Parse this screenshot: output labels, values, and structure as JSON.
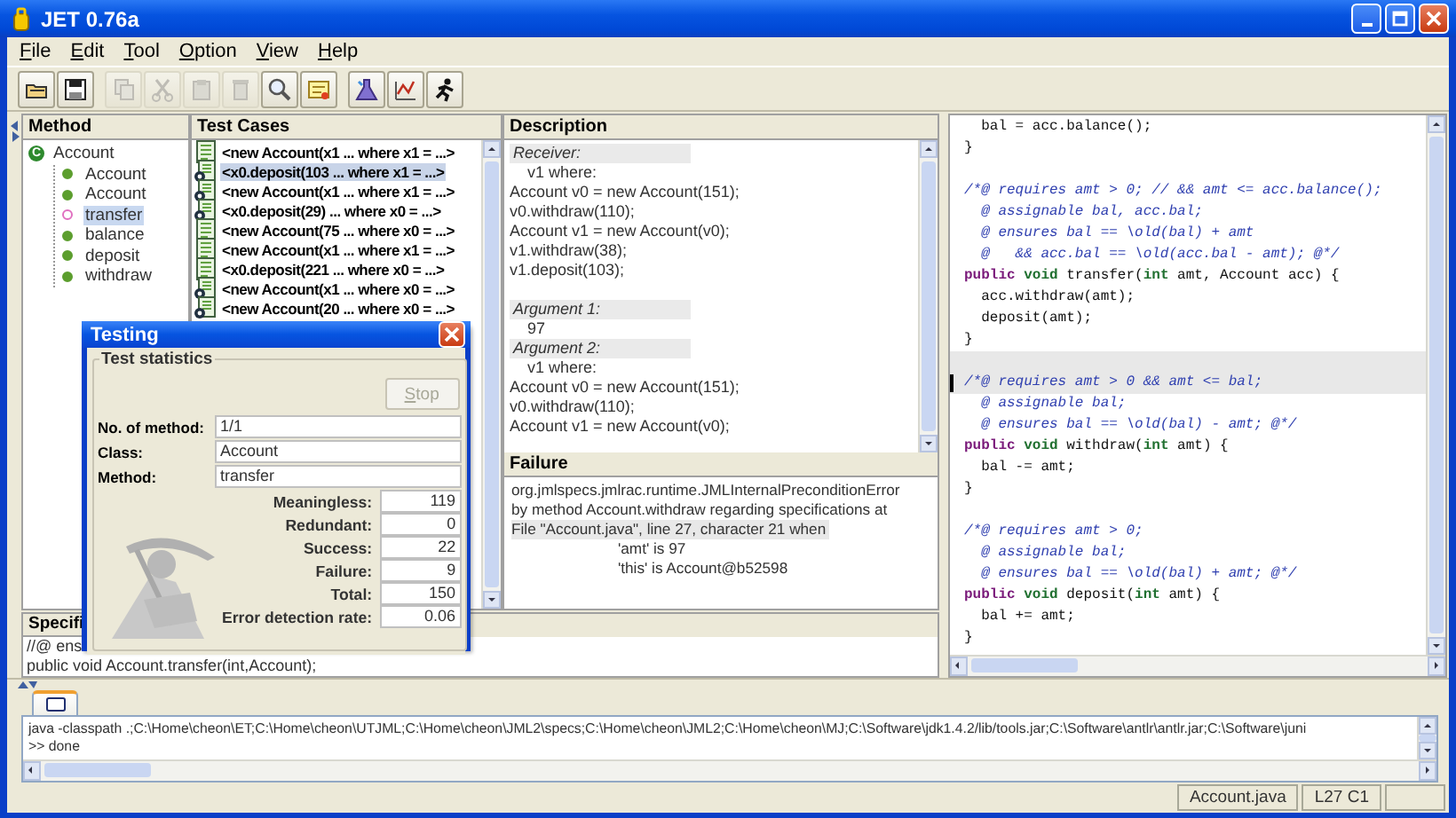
{
  "window": {
    "title": "JET 0.76a"
  },
  "menu": [
    "File",
    "Edit",
    "Tool",
    "Option",
    "View",
    "Help"
  ],
  "toolbar": [
    [
      {
        "kind": "open",
        "disabled": false
      },
      {
        "kind": "save",
        "disabled": false
      }
    ],
    [
      {
        "kind": "copy",
        "disabled": true
      },
      {
        "kind": "cut",
        "disabled": true
      },
      {
        "kind": "paste",
        "disabled": true
      },
      {
        "kind": "delete",
        "disabled": true
      },
      {
        "kind": "find",
        "disabled": false
      },
      {
        "kind": "note",
        "disabled": false
      }
    ],
    [
      {
        "kind": "spec",
        "disabled": false
      },
      {
        "kind": "chart",
        "disabled": false
      },
      {
        "kind": "run",
        "disabled": false
      }
    ]
  ],
  "method_panel": {
    "title": "Method",
    "root": {
      "label": "Account",
      "badge": "C",
      "children": [
        {
          "label": "Account",
          "kind": "filled",
          "color": "#5c9e2e",
          "selected": false
        },
        {
          "label": "Account",
          "kind": "filled",
          "color": "#5c9e2e",
          "selected": false
        },
        {
          "label": "transfer",
          "kind": "hollow",
          "color": "#e070c0",
          "selected": true
        },
        {
          "label": "balance",
          "kind": "filled",
          "color": "#5c9e2e",
          "selected": false
        },
        {
          "label": "deposit",
          "kind": "filled",
          "color": "#5c9e2e",
          "selected": false
        },
        {
          "label": "withdraw",
          "kind": "filled",
          "color": "#5c9e2e",
          "selected": false
        }
      ]
    }
  },
  "test_cases": {
    "title": "Test Cases",
    "rows": [
      {
        "kind": "plain",
        "text": "<new Account(x1 ... where x1 = ...>",
        "selected": false
      },
      {
        "kind": "marked",
        "text": "<x0.deposit(103 ... where x1 = ...>",
        "selected": true
      },
      {
        "kind": "marked",
        "text": "<new Account(x1 ... where x1 = ...>",
        "selected": false
      },
      {
        "kind": "marked",
        "text": "<x0.deposit(29) ... where x0 = ...>",
        "selected": false
      },
      {
        "kind": "plain",
        "text": "<new Account(75 ... where x0 = ...>",
        "selected": false
      },
      {
        "kind": "plain",
        "text": "<new Account(x1 ... where x1 = ...>",
        "selected": false
      },
      {
        "kind": "plain",
        "text": "<x0.deposit(221 ... where x0 = ...>",
        "selected": false
      },
      {
        "kind": "marked",
        "text": "<new Account(x1 ... where x0 = ...>",
        "selected": false
      },
      {
        "kind": "marked",
        "text": "<new Account(20 ... where x0 = ...>",
        "selected": false
      }
    ]
  },
  "description": {
    "title": "Description",
    "blocks": [
      {
        "kind": "heading",
        "text": "Receiver:"
      },
      {
        "kind": "indent",
        "text": "v1 where:"
      },
      {
        "kind": "code",
        "text": "Account v0 = new Account(151);"
      },
      {
        "kind": "code",
        "text": "v0.withdraw(110);"
      },
      {
        "kind": "code",
        "text": "Account v1 = new Account(v0);"
      },
      {
        "kind": "code",
        "text": "v1.withdraw(38);"
      },
      {
        "kind": "code",
        "text": "v1.deposit(103);"
      },
      {
        "kind": "gap"
      },
      {
        "kind": "heading",
        "text": "Argument 1:"
      },
      {
        "kind": "indent",
        "text": "97"
      },
      {
        "kind": "heading",
        "text": "Argument 2:"
      },
      {
        "kind": "indent",
        "text": "v1 where:"
      },
      {
        "kind": "code",
        "text": "Account v0 = new Account(151);"
      },
      {
        "kind": "code",
        "text": "v0.withdraw(110);"
      },
      {
        "kind": "code",
        "text": "Account v1 = new Account(v0);"
      }
    ]
  },
  "failure": {
    "title": "Failure",
    "lines": [
      {
        "kind": "plain",
        "text": "org.jmlspecs.jmlrac.runtime.JMLInternalPreconditionError"
      },
      {
        "kind": "plain",
        "text": "by method Account.withdraw regarding specifications at"
      },
      {
        "kind": "highlight",
        "text": "File \"Account.java\", line 27, character 21 when"
      },
      {
        "kind": "indent",
        "text": "'amt' is 97"
      },
      {
        "kind": "indent",
        "text": "'this' is Account@b52598"
      }
    ]
  },
  "specification": {
    "title": "Specifi",
    "lines": [
      "//@ ens",
      "public void Account.transfer(int,Account);"
    ]
  },
  "editor": {
    "lines": [
      {
        "current": false,
        "gap_before": false,
        "segments": [
          {
            "kind": "plain",
            "text": "  bal = acc.balance();"
          }
        ]
      },
      {
        "current": false,
        "gap_before": false,
        "segments": [
          {
            "kind": "plain",
            "text": "}"
          }
        ]
      },
      {
        "current": false,
        "gap_before": true,
        "segments": [
          {
            "kind": "comment",
            "text": "/*@ requires amt > 0; // && amt <= acc.balance();"
          }
        ]
      },
      {
        "current": false,
        "gap_before": false,
        "segments": [
          {
            "kind": "comment",
            "text": "  @ assignable bal, acc.bal;"
          }
        ]
      },
      {
        "current": false,
        "gap_before": false,
        "segments": [
          {
            "kind": "comment",
            "text": "  @ ensures bal == \\old(bal) + amt"
          }
        ]
      },
      {
        "current": false,
        "gap_before": false,
        "segments": [
          {
            "kind": "comment",
            "text": "  @   && acc.bal == \\old(acc.bal - amt); @*/"
          }
        ]
      },
      {
        "current": false,
        "gap_before": false,
        "segments": [
          {
            "kind": "keyword",
            "text": "public"
          },
          {
            "kind": "type",
            "text": " void"
          },
          {
            "kind": "plain",
            "text": " transfer("
          },
          {
            "kind": "type",
            "text": "int"
          },
          {
            "kind": "plain",
            "text": " amt, Account acc) {"
          }
        ]
      },
      {
        "current": false,
        "gap_before": false,
        "segments": [
          {
            "kind": "plain",
            "text": "  acc.withdraw(amt);"
          }
        ]
      },
      {
        "current": false,
        "gap_before": false,
        "segments": [
          {
            "kind": "plain",
            "text": "  deposit(amt);"
          }
        ]
      },
      {
        "current": false,
        "gap_before": false,
        "segments": [
          {
            "kind": "plain",
            "text": "}"
          }
        ]
      },
      {
        "current": true,
        "gap_before": true,
        "segments": [
          {
            "kind": "comment",
            "text": "/*@ requires amt > 0 && amt <= bal;"
          }
        ]
      },
      {
        "current": false,
        "gap_before": false,
        "segments": [
          {
            "kind": "comment",
            "text": "  @ assignable bal;"
          }
        ]
      },
      {
        "current": false,
        "gap_before": false,
        "segments": [
          {
            "kind": "comment",
            "text": "  @ ensures bal == \\old(bal) - amt; @*/"
          }
        ]
      },
      {
        "current": false,
        "gap_before": false,
        "segments": [
          {
            "kind": "keyword",
            "text": "public"
          },
          {
            "kind": "type",
            "text": " void"
          },
          {
            "kind": "plain",
            "text": " withdraw("
          },
          {
            "kind": "type",
            "text": "int"
          },
          {
            "kind": "plain",
            "text": " amt) {"
          }
        ]
      },
      {
        "current": false,
        "gap_before": false,
        "segments": [
          {
            "kind": "plain",
            "text": "  bal -= amt;"
          }
        ]
      },
      {
        "current": false,
        "gap_before": false,
        "segments": [
          {
            "kind": "plain",
            "text": "}"
          }
        ]
      },
      {
        "current": false,
        "gap_before": true,
        "segments": [
          {
            "kind": "comment",
            "text": "/*@ requires amt > 0;"
          }
        ]
      },
      {
        "current": false,
        "gap_before": false,
        "segments": [
          {
            "kind": "comment",
            "text": "  @ assignable bal;"
          }
        ]
      },
      {
        "current": false,
        "gap_before": false,
        "segments": [
          {
            "kind": "comment",
            "text": "  @ ensures bal == \\old(bal) + amt; @*/"
          }
        ]
      },
      {
        "current": false,
        "gap_before": false,
        "segments": [
          {
            "kind": "keyword",
            "text": "public"
          },
          {
            "kind": "type",
            "text": " void"
          },
          {
            "kind": "plain",
            "text": " deposit("
          },
          {
            "kind": "type",
            "text": "int"
          },
          {
            "kind": "plain",
            "text": " amt) {"
          }
        ]
      },
      {
        "current": false,
        "gap_before": false,
        "segments": [
          {
            "kind": "plain",
            "text": "  bal += amt;"
          }
        ]
      },
      {
        "current": false,
        "gap_before": false,
        "segments": [
          {
            "kind": "plain",
            "text": "}"
          }
        ]
      }
    ]
  },
  "console": {
    "tab": {
      "selected": true
    },
    "lines": [
      "java -classpath .;C:\\Home\\cheon\\ET;C:\\Home\\cheon\\UTJML;C:\\Home\\cheon\\JML2\\specs;C:\\Home\\cheon\\JML2;C:\\Home\\cheon\\MJ;C:\\Software\\jdk1.4.2/lib/tools.jar;C:\\Software\\antlr\\antlr.jar;C:\\Software\\juni",
      ">> done"
    ]
  },
  "status_bar": [
    "Account.java",
    "L27 C1"
  ],
  "dialog": {
    "title": "Testing",
    "group": "Test statistics",
    "stop": {
      "label": "Stop",
      "disabled": true
    },
    "fields": [
      {
        "label": "No. of method:",
        "value": "1/1"
      },
      {
        "label": "Class:",
        "value": "Account"
      },
      {
        "label": "Method:",
        "value": "transfer"
      }
    ],
    "stats": [
      {
        "label": "Meaningless:",
        "value": "119"
      },
      {
        "label": "Redundant:",
        "value": "0"
      },
      {
        "label": "Success:",
        "value": "22"
      },
      {
        "label": "Failure:",
        "value": "9"
      },
      {
        "label": "Total:",
        "value": "150"
      },
      {
        "label": "Error detection rate:",
        "value": "0.06"
      }
    ]
  }
}
